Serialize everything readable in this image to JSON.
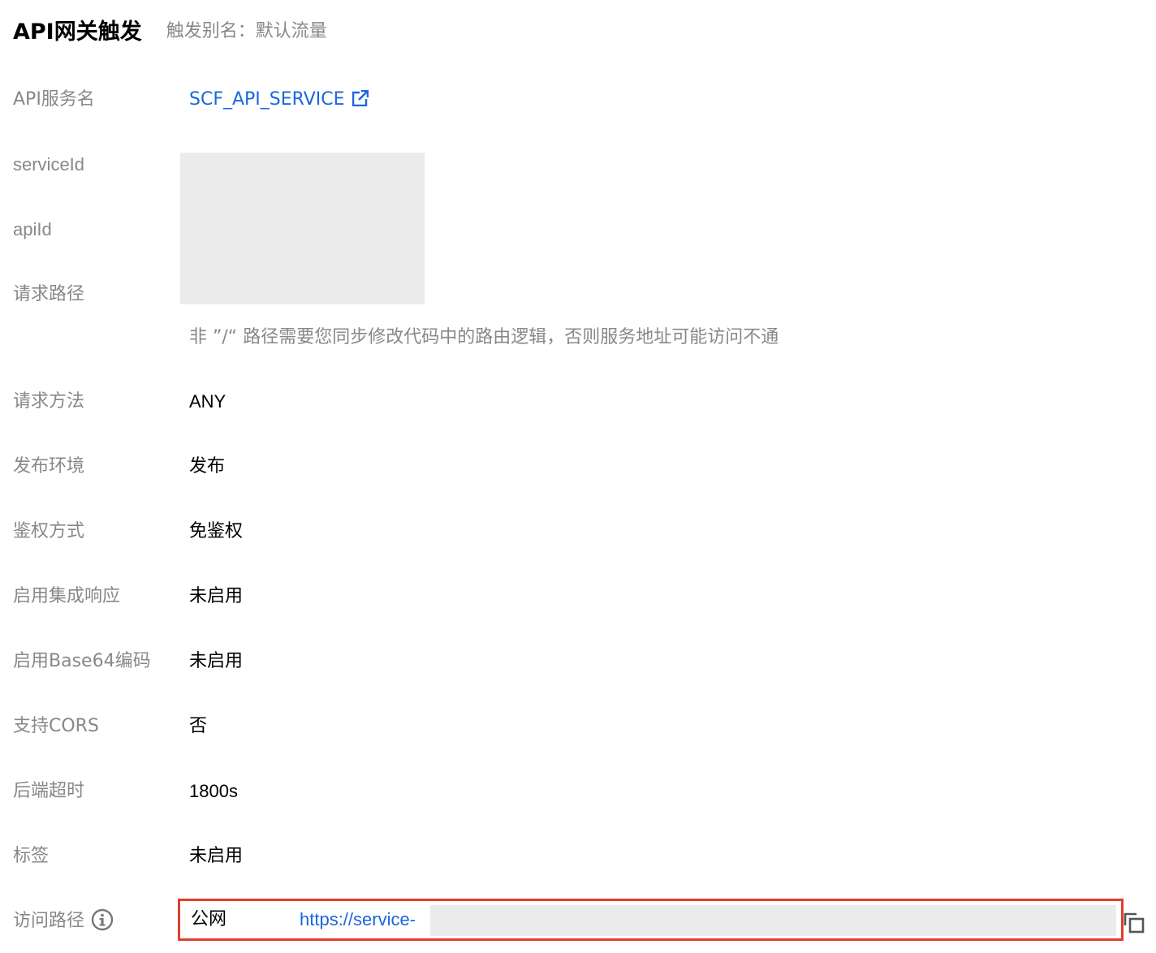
{
  "header": {
    "title": "API网关触发",
    "alias_label": "触发别名：默认流量"
  },
  "fields": {
    "api_service_name": {
      "label": "API服务名",
      "value": "SCF_API_SERVICE"
    },
    "service_id": {
      "label": "serviceId"
    },
    "api_id": {
      "label": "apiId"
    },
    "request_path": {
      "label": "请求路径",
      "hint": "非 ”/“ 路径需要您同步修改代码中的路由逻辑，否则服务地址可能访问不通"
    },
    "request_method": {
      "label": "请求方法",
      "value": "ANY"
    },
    "release_env": {
      "label": "发布环境",
      "value": "发布"
    },
    "auth_method": {
      "label": "鉴权方式",
      "value": "免鉴权"
    },
    "integrated_response": {
      "label": "启用集成响应",
      "value": "未启用"
    },
    "base64_encoding": {
      "label": "启用Base64编码",
      "value": "未启用"
    },
    "cors": {
      "label": "支持CORS",
      "value": "否"
    },
    "backend_timeout": {
      "label": "后端超时",
      "value": "1800s"
    },
    "tags": {
      "label": "标签",
      "value": "未启用"
    },
    "access_path": {
      "label": "访问路径",
      "network": "公网",
      "url": "https://service-"
    }
  },
  "icons": {
    "external_link": "external-link-icon",
    "info": "info-icon",
    "copy": "copy-icon"
  },
  "colors": {
    "link": "#1a66dd",
    "label": "#888888",
    "highlight_border": "#e03e2d",
    "redaction": "#ebebeb"
  }
}
